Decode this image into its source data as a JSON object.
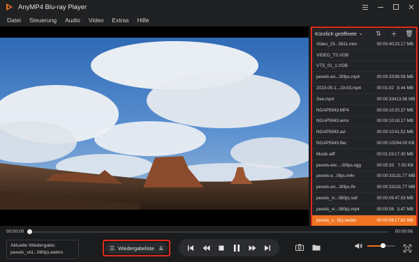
{
  "window": {
    "title": "AnyMP4 Blu-ray Player"
  },
  "menu": [
    "Datei",
    "Steuerung",
    "Audio",
    "Video",
    "Extras",
    "Hilfe"
  ],
  "playlist": {
    "header": "Kürzlich geöffnete",
    "items": [
      {
        "name": "Video_23...5811.mkv",
        "duration": "00:00:40",
        "size": "23.17 MB",
        "active": false
      },
      {
        "name": "VIDEO_TS.VOB",
        "duration": "",
        "size": "",
        "active": false
      },
      {
        "name": "VTS_01_1.VOB",
        "duration": "",
        "size": "",
        "active": false
      },
      {
        "name": "pexels-en...30fps.mp4",
        "duration": "00:00:33",
        "size": "98.08 MB",
        "active": false
      },
      {
        "name": "2023-05-1...19-03.mp4",
        "duration": "00:01:02",
        "size": "8.44 MB",
        "active": false
      },
      {
        "name": "See.mp4",
        "duration": "00:00:33",
        "size": "413.56 MB",
        "active": false
      },
      {
        "name": "NGAP5943.MP4",
        "duration": "00:00:10",
        "size": "20.37 MB",
        "active": false
      },
      {
        "name": "NGAP5943.wmv",
        "duration": "00:00:10",
        "size": "18.17 MB",
        "active": false
      },
      {
        "name": "NGAP5943.avi",
        "duration": "00:00:10",
        "size": "41.52 MB",
        "active": false
      },
      {
        "name": "NGAP5943.flac",
        "duration": "00:00:10",
        "size": "294.00 KB",
        "active": false
      },
      {
        "name": "Musik.aiff",
        "duration": "00:01:03",
        "size": "17.30 MB",
        "active": false
      },
      {
        "name": "pexels-enr...-30fps.ogg",
        "duration": "00:00:33",
        "size": "7.00 KB",
        "active": false
      },
      {
        "name": "pexels-e...0fps.m4v",
        "duration": "00:00:33",
        "size": "131.77 MB",
        "active": false
      },
      {
        "name": "pexels-en...30fps.flv",
        "duration": "00:00:33",
        "size": "131.77 MB",
        "active": false
      },
      {
        "name": "pexels_vi...080p).swf",
        "duration": "00:00:06",
        "size": "47.03 MB",
        "active": false
      },
      {
        "name": "pexels_vi...080p).mp4",
        "duration": "00:00:06",
        "size": "3.47 MB",
        "active": false
      },
      {
        "name": "pexels_v...0p).webm",
        "duration": "00:00:06",
        "size": "17.62 MB",
        "active": true
      }
    ]
  },
  "timeline": {
    "current": "00:00:00",
    "total": "00:00:06",
    "progress": 0
  },
  "now_playing": {
    "label": "Aktuelle Wiedergabe:",
    "file": "pexels_vid...080p).webm"
  },
  "playlist_toggle": {
    "label": "Wiedergabeliste"
  },
  "volume": {
    "level": 0.55
  },
  "colors": {
    "accent": "#f07422",
    "highlight_border": "#e02a1c"
  }
}
